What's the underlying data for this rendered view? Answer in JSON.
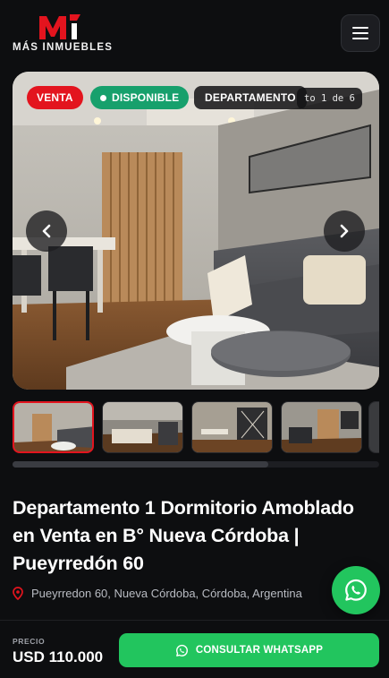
{
  "header": {
    "logo_text": "MÁS INMUEBLES",
    "menu_icon": "hamburger-menu-icon"
  },
  "gallery": {
    "badges": {
      "operation": "VENTA",
      "status": "DISPONIBLE",
      "type": "DEPARTAMENTO"
    },
    "counter": "to 1 de 6",
    "prev_icon": "chevron-left-icon",
    "next_icon": "chevron-right-icon",
    "thumbnail_count": 5,
    "active_thumbnail": 1
  },
  "listing": {
    "title": "Departamento 1 Dormitorio Amoblado en Venta en B° Nueva Córdoba | Pueyrredón 60",
    "address": "Pueyrredon 60, Nueva Córdoba, Córdoba, Argentina",
    "address_icon": "map-pin-icon"
  },
  "footer": {
    "price_label": "PRECIO",
    "price_value": "USD 110.000",
    "cta_label": "CONSULTAR WHATSAPP",
    "cta_icon": "whatsapp-icon"
  },
  "colors": {
    "background": "#0d0e10",
    "accent_red": "#e3141e",
    "status_green": "#17a06c",
    "whatsapp_green": "#22c55e"
  }
}
